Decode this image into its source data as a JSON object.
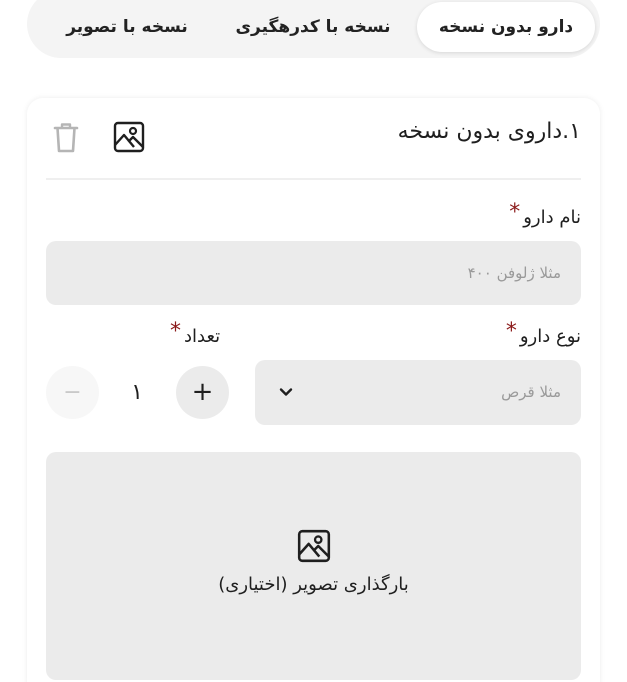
{
  "tabs": [
    {
      "label": "دارو بدون نسخه",
      "active": true
    },
    {
      "label": "نسخه با کدرهگیری",
      "active": false
    },
    {
      "label": "نسخه با تصویر",
      "active": false
    }
  ],
  "card": {
    "title": "۱.داروی بدون نسخه",
    "image_icon": "image-icon",
    "trash_icon": "trash-icon"
  },
  "form": {
    "required_mark": "*",
    "drug_name": {
      "label": "نام دارو",
      "placeholder": "مثلا ژلوفن ۴۰۰",
      "value": ""
    },
    "drug_type": {
      "label": "نوع دارو",
      "placeholder": "مثلا قرص",
      "icon": "chevron-down-icon"
    },
    "quantity": {
      "label": "تعداد",
      "value": "۱",
      "increment": "+",
      "decrement": "−"
    },
    "upload": {
      "label": "بارگذاری تصویر (اختیاری)",
      "icon": "image-icon"
    }
  },
  "colors": {
    "accent_required": "#8b1a1a",
    "field_bg": "#ebebeb",
    "tab_bar_bg": "#f4f4f4"
  }
}
